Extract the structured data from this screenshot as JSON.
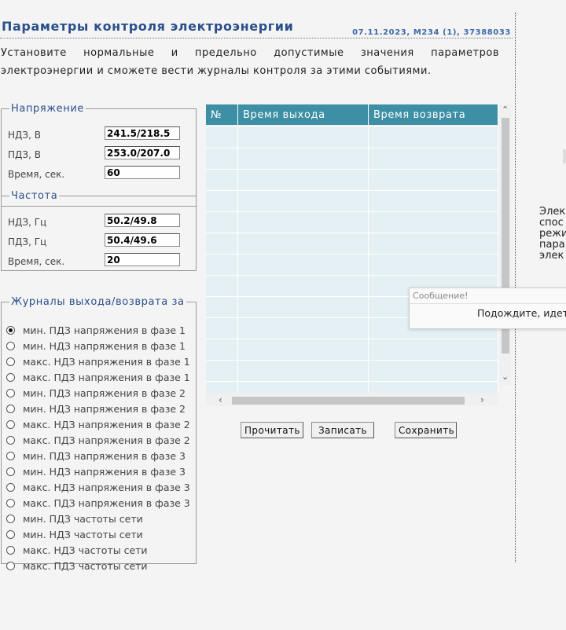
{
  "header": {
    "title": "Параметры контроля электроэнергии",
    "meta": "07.11.2023, M234 (1), 37388033"
  },
  "intro": "Установите нормальные и предельно допустимые значения параметров электроэнергии и сможете вести журналы контроля за этими событиями.",
  "voltage": {
    "legend": "Напряжение",
    "ndz_label": "НДЗ, В",
    "ndz_value": "241.5/218.5",
    "pdz_label": "ПДЗ, В",
    "pdz_value": "253.0/207.0",
    "time_label": "Время, сек.",
    "time_value": "60"
  },
  "frequency": {
    "legend": "Частота",
    "ndz_label": "НДЗ, Гц",
    "ndz_value": "50.2/49.8",
    "pdz_label": "ПДЗ, Гц",
    "pdz_value": "50.4/49.6",
    "time_label": "Время, сек.",
    "time_value": "20"
  },
  "journals": {
    "legend": "Журналы выхода/возврата за",
    "selected_index": 0,
    "items": [
      "мин. ПДЗ напряжения в фазе 1",
      "мин. НДЗ напряжения в фазе 1",
      "макс. НДЗ напряжения в фазе 1",
      "макс. ПДЗ напряжения в фазе 1",
      "мин. ПДЗ напряжения в фазе 2",
      "мин. НДЗ напряжения в фазе 2",
      "макс. НДЗ напряжения в фазе 2",
      "макс. ПДЗ напряжения в фазе 2",
      "мин. ПДЗ напряжения в фазе 3",
      "мин. НДЗ напряжения в фазе 3",
      "макс. НДЗ напряжения в фазе 3",
      "макс. ПДЗ напряжения в фазе 3",
      "мин. ПДЗ частоты сети",
      "мин. НДЗ частоты сети",
      "макс. НДЗ частоты сети",
      "макс. ПДЗ частоты сети"
    ]
  },
  "table": {
    "columns": [
      "№",
      "Время выхода",
      "Время возврата"
    ],
    "empty_rows": 13
  },
  "buttons": {
    "read": "Прочитать",
    "write": "Записать",
    "save": "Сохранить"
  },
  "popup": {
    "title": "Сообщение!",
    "message": "Подождите, идет"
  },
  "side_text": [
    "Элек",
    "спос",
    "режи",
    "пара",
    "элек"
  ],
  "colors": {
    "accent": "#2b4f8c",
    "table_header": "#3c8fa4",
    "table_cell": "#e4f0f4"
  }
}
